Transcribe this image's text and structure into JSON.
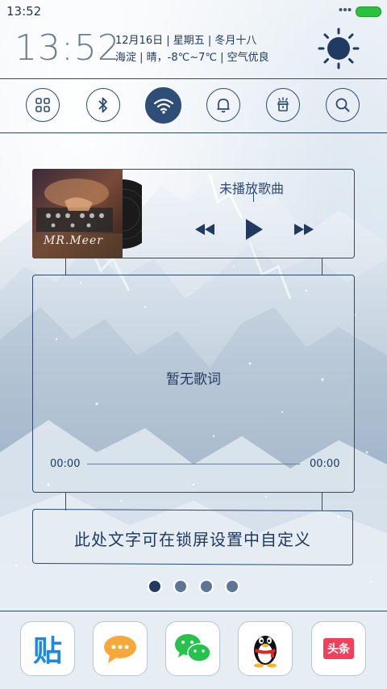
{
  "status_bar": {
    "time": "13:52",
    "battery_color": "#2bc13e",
    "icons": [
      "more-dots-icon",
      "battery-icon"
    ]
  },
  "header": {
    "time": "13:52",
    "date_line": "12月16日 | 星期五 | 冬月十八",
    "weather_line": "海淀 | 晴，-8℃~7℃ | 空气优良",
    "weather_icon": "sun-icon"
  },
  "toggles": [
    {
      "name": "apps-grid",
      "icon": "apps-grid-icon",
      "active": false
    },
    {
      "name": "bluetooth",
      "icon": "bluetooth-icon",
      "active": false
    },
    {
      "name": "wifi",
      "icon": "wifi-icon",
      "active": true
    },
    {
      "name": "notification",
      "icon": "bell-icon",
      "active": false
    },
    {
      "name": "flashlight",
      "icon": "flashlight-icon",
      "active": false
    },
    {
      "name": "search",
      "icon": "search-icon",
      "active": false
    }
  ],
  "music": {
    "song_title": "未播放歌曲",
    "album_caption": "MR.Meer",
    "controls": [
      "rewind-icon",
      "play-icon",
      "fast-forward-icon"
    ],
    "lyrics": "暂无歌词",
    "time_start": "00:00",
    "time_end": "00:00",
    "progress": 0
  },
  "custom_text": "此处文字可在锁屏设置中自定义",
  "page_indicator": {
    "count": 4,
    "active_index": 0
  },
  "dock": {
    "apps": [
      {
        "name": "tieba",
        "icon": "tieba-icon",
        "label": "贴"
      },
      {
        "name": "chat-bubble-app",
        "icon": "chat-bubble-icon"
      },
      {
        "name": "wechat",
        "icon": "wechat-icon"
      },
      {
        "name": "qq",
        "icon": "qq-penguin-icon"
      },
      {
        "name": "toutiao",
        "icon": "toutiao-icon",
        "label": "头条"
      }
    ]
  },
  "colors": {
    "accent": "#2c4a75",
    "text": "#1f3a63",
    "wechat": "#27c24c",
    "toutiao": "#f2405b",
    "tieba": "#1e88e5"
  }
}
